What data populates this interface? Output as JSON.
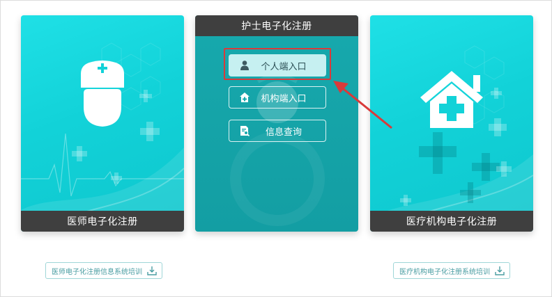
{
  "cards": {
    "doctor": {
      "title": "医师电子化注册"
    },
    "nurse": {
      "title": "护士电子化注册",
      "buttons": [
        {
          "label": "个人端入口",
          "icon": "person-icon",
          "selected": true
        },
        {
          "label": "机构端入口",
          "icon": "institution-home-icon",
          "selected": false
        },
        {
          "label": "信息查询",
          "icon": "document-search-icon",
          "selected": false
        }
      ]
    },
    "institution": {
      "title": "医疗机构电子化注册"
    }
  },
  "training": {
    "left_label": "医师电子化注册信息系统培训",
    "right_label": "医疗机构电子化注册系统培训",
    "icon": "download-icon"
  },
  "colors": {
    "cyan": "#12d2d8",
    "teal": "#17a9ad",
    "dark_bar": "#3f3f3f",
    "highlight_red": "#d93a3a"
  }
}
